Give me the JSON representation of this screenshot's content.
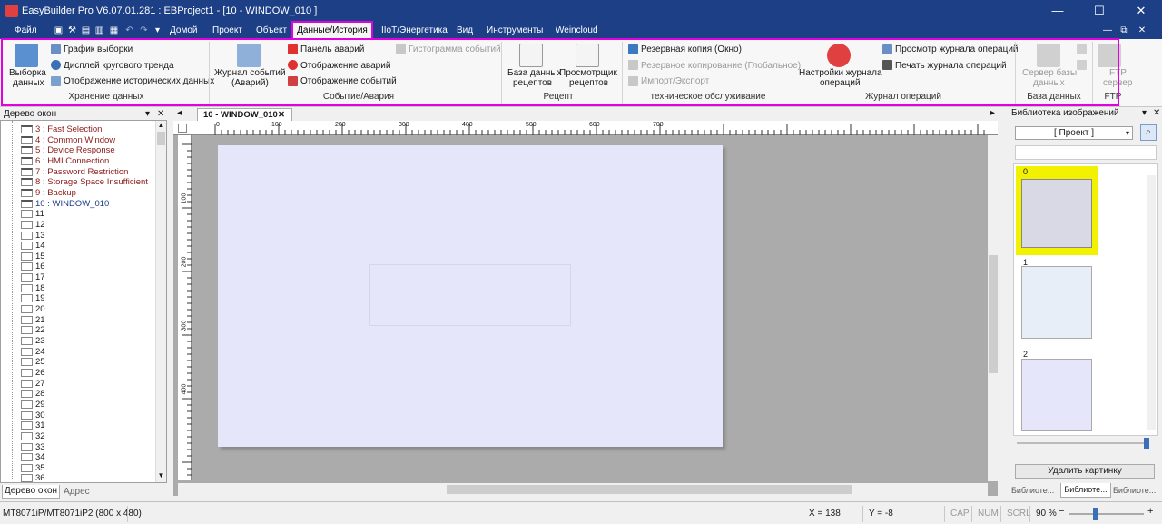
{
  "title_bar": {
    "title": "EasyBuilder Pro V6.07.01.281 : EBProject1 - [10 - WINDOW_010 ]",
    "min": "—",
    "max": "☐",
    "close": "✕"
  },
  "menu": {
    "file": "Файл",
    "items": [
      "Домой",
      "Проект",
      "Объект",
      "Данные/История",
      "IIoT/Энергетика",
      "Вид",
      "Инструменты",
      "Weincloud"
    ],
    "mdi": [
      "—",
      "⧉",
      "✕"
    ]
  },
  "ribbon": {
    "data_storage": {
      "big_line1": "Выборка",
      "big_line2": "данных",
      "items": [
        "График выборки",
        "Дисплей кругового тренда",
        "Отображение исторических данных"
      ],
      "label": "Хранение данных"
    },
    "events": {
      "big_line1": "Журнал событий",
      "big_line2": "(Аварий)",
      "items": [
        "Панель аварий",
        "Отображение аварий",
        "Отображение событий"
      ],
      "disabled_item": "Гистограмма событий",
      "label": "Событие/Авария"
    },
    "recipe": {
      "db_line1": "База данных",
      "db_line2": "рецептов",
      "view_line1": "Просмотрщик",
      "view_line2": "рецептов",
      "label": "Рецепт"
    },
    "maintenance": {
      "items": [
        "Резервная копия (Окно)",
        "Резервное копирование (Глобальное)",
        "Импорт/Экспорт"
      ],
      "label": "техническое обслуживание"
    },
    "oplog": {
      "big_line1": "Настройки журнала",
      "big_line2": "операций",
      "items": [
        "Просмотр журнала операций",
        "Печать журнала операций"
      ],
      "label": "Журнал операций"
    },
    "database": {
      "line1": "Сервер базы",
      "line2": "данных",
      "label": "База данных"
    },
    "ftp": {
      "line1": "FTP",
      "line2": "сервер",
      "label": "FTP"
    }
  },
  "window_tree": {
    "title": "Дерево окон",
    "items": [
      "3 : Fast Selection",
      "4 : Common Window",
      "5 : Device Response",
      "6 : HMI Connection",
      "7 : Password Restriction",
      "8 : Storage Space Insufficient",
      "9 : Backup",
      "10 : WINDOW_010",
      "11",
      "12",
      "13",
      "14",
      "15",
      "16",
      "17",
      "18",
      "19",
      "20",
      "21",
      "22",
      "23",
      "24",
      "25",
      "26",
      "27",
      "28",
      "29",
      "30",
      "31",
      "32",
      "33",
      "34",
      "35",
      "36"
    ],
    "tabs": [
      "Дерево окон",
      "Адрес"
    ]
  },
  "editor": {
    "tab_title": "10 - WINDOW_010",
    "ruler_ticks": [
      "0",
      "100",
      "200",
      "300",
      "400",
      "500",
      "600",
      "700"
    ],
    "ruler_left_ticks": [
      "100",
      "200",
      "300",
      "400"
    ]
  },
  "library": {
    "title": "Библиотека изображений",
    "dropdown": "[ Проект ]",
    "thumbs": [
      "0",
      "1",
      "2"
    ],
    "delete_button": "Удалить картинку",
    "tabs": [
      "Библиоте...",
      "Библиоте...",
      "Библиоте..."
    ]
  },
  "status_bar": {
    "model": "MT8071iP/MT8071iP2 (800 x 480)",
    "x": "X = 138",
    "y": "Y = -8",
    "cap": "CAP",
    "num": "NUM",
    "scrl": "SCRL",
    "zoom": "90 %"
  },
  "colors": {
    "accent": "#1c3f86",
    "highlight": "#e000e0",
    "sheet": "#e6e6fa",
    "selection": "#f2f200"
  }
}
